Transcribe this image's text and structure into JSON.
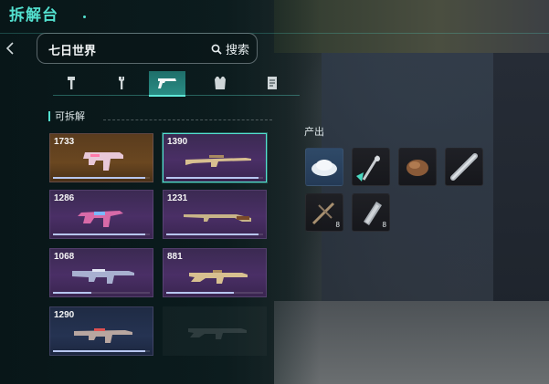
{
  "header": {
    "title": "拆解台"
  },
  "search": {
    "value": "七日世界",
    "button_label": "搜索"
  },
  "tabs": [
    {
      "icon": "hammer-icon"
    },
    {
      "icon": "wrench-icon"
    },
    {
      "icon": "pistol-icon",
      "active": true
    },
    {
      "icon": "armor-vest-icon"
    },
    {
      "icon": "document-icon"
    }
  ],
  "section": {
    "label": "可拆解"
  },
  "items": [
    {
      "number": "1733",
      "weapon": "smg-icon",
      "rarity": "gold",
      "progress": 0.95
    },
    {
      "number": "1390",
      "weapon": "sniper-rifle-icon",
      "rarity": "purple",
      "progress": 0.95,
      "selected": true
    },
    {
      "number": "1286",
      "weapon": "smg-icon",
      "rarity": "purple",
      "progress": 0.95
    },
    {
      "number": "1231",
      "weapon": "hunting-rifle-icon",
      "rarity": "purple",
      "progress": 0.95
    },
    {
      "number": "1068",
      "weapon": "assault-rifle-icon",
      "rarity": "purple",
      "progress": 0.4
    },
    {
      "number": "881",
      "weapon": "rifle-icon",
      "rarity": "purple",
      "progress": 0.7
    },
    {
      "number": "1290",
      "weapon": "assault-rifle-icon",
      "rarity": "blue",
      "progress": 0.95
    }
  ],
  "output": {
    "label": "产出",
    "slots": [
      {
        "icon": "powder-pile-icon",
        "count": ""
      },
      {
        "icon": "crystal-branch-icon",
        "count": ""
      },
      {
        "icon": "ore-chunk-icon",
        "count": ""
      },
      {
        "icon": "metal-pipe-icon",
        "count": ""
      },
      {
        "icon": "crossbow-part-icon",
        "count": "8"
      },
      {
        "icon": "steel-plate-icon",
        "count": "8"
      }
    ]
  }
}
